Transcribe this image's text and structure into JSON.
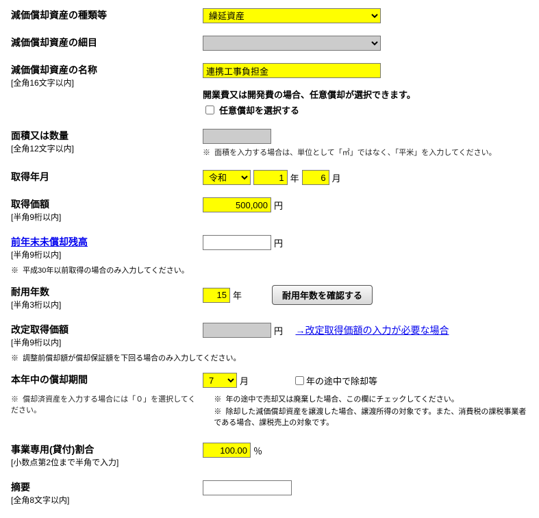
{
  "asset_type": {
    "label": "減価償却資産の種類等",
    "value": "繰延資産"
  },
  "asset_detail": {
    "label": "減価償却資産の細目",
    "value": ""
  },
  "asset_name": {
    "label": "減価償却資産の名称",
    "sub": "[全角16文字以内]",
    "value": "連携工事負担金",
    "info": "開業費又は開発費の場合、任意償却が選択できます。",
    "checkbox_label": "任意償却を選択する"
  },
  "area_qty": {
    "label": "面積又は数量",
    "sub": "[全角12文字以内]",
    "note_prefix": "※",
    "note": "面積を入力する場合は、単位として「㎡」ではなく、「平米」を入力してください。"
  },
  "acq_date": {
    "label": "取得年月",
    "era": "令和",
    "year": "1",
    "year_unit": "年",
    "month": "6",
    "month_unit": "月"
  },
  "acq_price": {
    "label": "取得価額",
    "sub": "[半角9桁以内]",
    "value": "500,000",
    "unit": "円"
  },
  "prev_balance": {
    "label": "前年末未償却残高",
    "sub": "[半角9桁以内]",
    "value": "",
    "unit": "円",
    "note_prefix": "※",
    "note": "平成30年以前取得の場合のみ入力してください。"
  },
  "useful_life": {
    "label": "耐用年数",
    "sub": "[半角3桁以内]",
    "value": "15",
    "unit": "年",
    "button": "耐用年数を確認する"
  },
  "revised_price": {
    "label": "改定取得価額",
    "sub": "[半角9桁以内]",
    "unit": "円",
    "link": "→改定取得価額の入力が必要な場合",
    "note_prefix": "※",
    "note": "調整前償却額が償却保証額を下回る場合のみ入力してください。"
  },
  "dep_period": {
    "label": "本年中の償却期間",
    "value": "7",
    "unit": "月",
    "checkbox_label": "年の途中で除却等",
    "left_note_prefix": "※",
    "left_note": "償却済資産を入力する場合には「０」を選択してください。",
    "right_note1_prefix": "※",
    "right_note1": "年の途中で売却又は廃棄した場合、この欄にチェックしてください。",
    "right_note2_prefix": "※",
    "right_note2": "除却した減価償却資産を譲渡した場合、譲渡所得の対象です。また、消費税の課税事業者である場合、課税売上の対象です。"
  },
  "biz_ratio": {
    "label": "事業専用(貸付)割合",
    "sub": "[小数点第2位まで半角で入力]",
    "value": "100.00",
    "unit": "％"
  },
  "summary": {
    "label": "摘要",
    "sub": "[全角8文字以内]",
    "value": ""
  }
}
